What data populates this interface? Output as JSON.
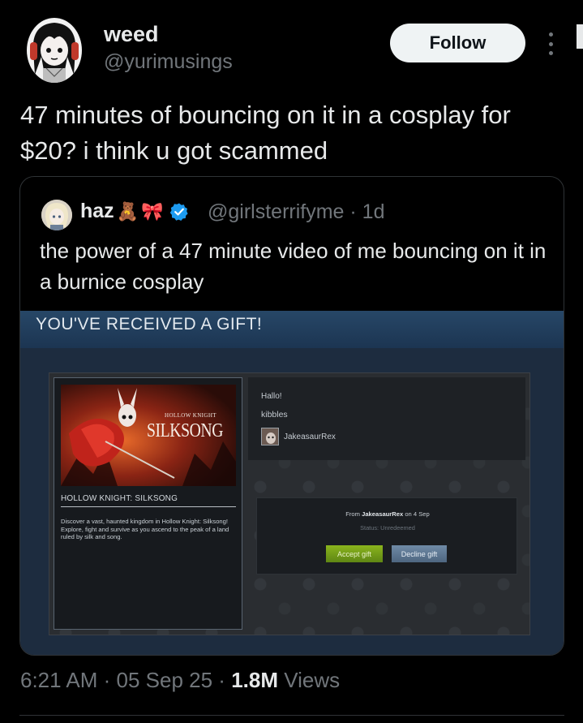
{
  "author": {
    "display_name": "weed",
    "handle": "@yurimusings",
    "follow_label": "Follow"
  },
  "tweet": {
    "text": "47 minutes of bouncing on it in a cosplay for $20? i think u got scammed"
  },
  "quoted": {
    "display_name": "haz",
    "emoji_1": "🧸",
    "emoji_2": "🎀",
    "handle_time": "@girlsterrifyme · 1d",
    "text": "the power of a 47 minute video of me bouncing on it in a burnice cosplay",
    "steam": {
      "header": "YOU'VE RECEIVED A GIFT!",
      "art_small_title": "HOLLOW KNIGHT",
      "art_big_title": "SILKSONG",
      "game_title": "HOLLOW KNIGHT: SILKSONG",
      "game_desc": "Discover a vast, haunted kingdom in Hollow Knight: Silksong! Explore, fight and survive as you ascend to the peak of a land ruled by silk and song.",
      "msg_greeting": "Hallo!",
      "msg_body": "kibbles",
      "sender": "JakeasaurRex",
      "from_prefix": "From",
      "from_name": "JakeasaurRex",
      "from_suffix": "on 4 Sep",
      "status": "Status: Unredeemed",
      "accept_label": "Accept gift",
      "decline_label": "Decline gift",
      "colors": {
        "accept": "#7aa61a",
        "decline": "#5f7a96",
        "header": "#274767"
      }
    }
  },
  "meta": {
    "time": "6:21 AM",
    "sep1": " · ",
    "date": "05 Sep 25",
    "sep2": " · ",
    "views_count": "1.8M",
    "views_label": " Views"
  },
  "icons": [
    "more-vertical-icon",
    "verified-badge-icon"
  ],
  "colors": {
    "background": "#000000",
    "text": "#e7e9ea",
    "muted": "#71767b",
    "verified": "#1d9bf0"
  }
}
